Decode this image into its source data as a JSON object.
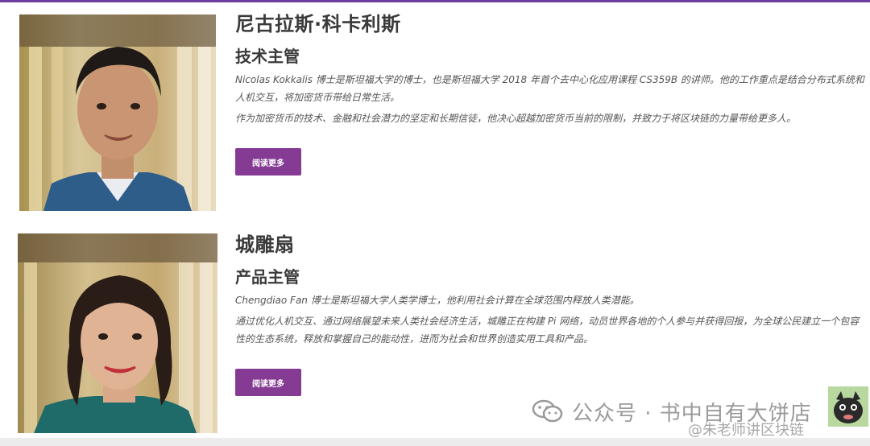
{
  "members": [
    {
      "name": "尼古拉斯·科卡利斯",
      "role": "技术主管",
      "desc_1": "Nicolas Kokkalis 博士是斯坦福大学的博士，也是斯坦福大学 2018 年首个去中心化应用课程 CS359B 的讲师。他的工作重点是结合分布式系统和人机交互，将加密货币带给日常生活。",
      "desc_2": "作为加密货币的技术、金融和社会潜力的坚定和长期信徒，他决心超越加密货币当前的限制，并致力于将区块链的力量带给更多人。",
      "button": "阅读更多"
    },
    {
      "name": "城雕扇",
      "role": "产品主管",
      "desc_1": "Chengdiao Fan 博士是斯坦福大学人类学博士，他利用社会计算在全球范围内释放人类潜能。",
      "desc_2": "通过优化人机交互、通过网络展望未来人类社会经济生活，城雕正在构建 Pi 网络，动员世界各地的个人参与并获得回报，为全球公民建立一个包容性的生态系统，释放和掌握自己的能动性，进而为社会和世界创造实用工具和产品。",
      "button": "阅读更多"
    }
  ],
  "watermark": {
    "main": "公众号 · 书中自有大饼店",
    "sub": "@朱老师讲区块链"
  },
  "colors": {
    "accent": "#853a94",
    "top_border": "#6b3fa0"
  }
}
